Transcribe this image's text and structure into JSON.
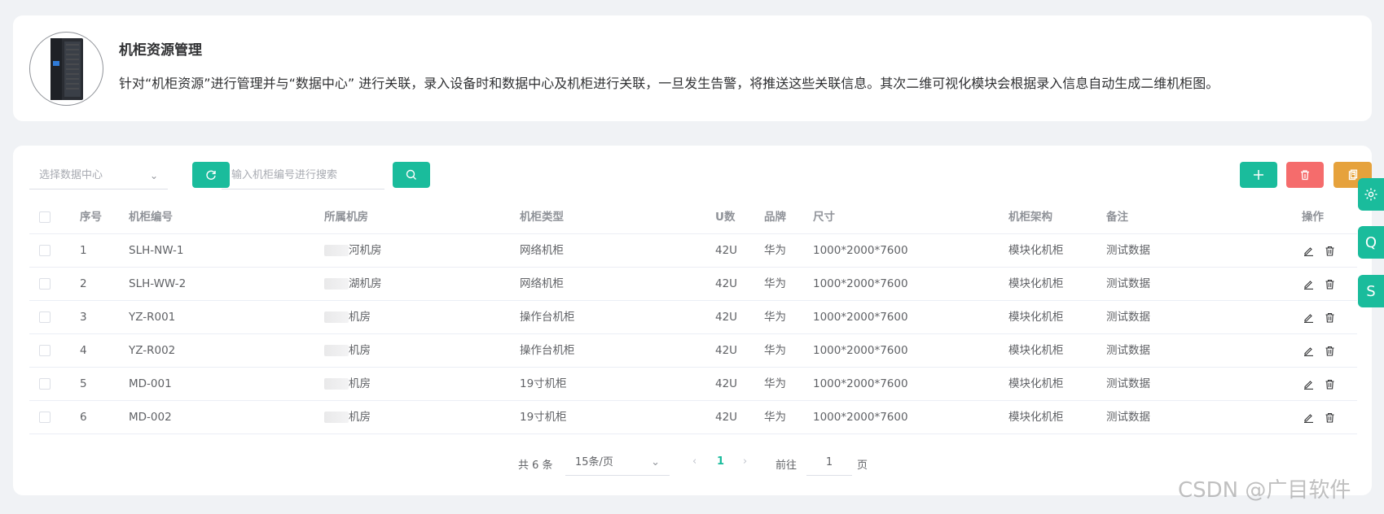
{
  "intro": {
    "title": "机柜资源管理",
    "description": "针对“机柜资源”进行管理并与“数据中心” 进行关联，录入设备时和数据中心及机柜进行关联，一旦发生告警，将推送这些关联信息。其次二维可视化模块会根据录入信息自动生成二维机柜图。"
  },
  "toolbar": {
    "datacenter_placeholder": "选择数据中心",
    "search_placeholder": "输入机柜编号进行搜索"
  },
  "table": {
    "headers": {
      "idx": "序号",
      "code": "机柜编号",
      "room": "所属机房",
      "type": "机柜类型",
      "u": "U数",
      "brand": "品牌",
      "size": "尺寸",
      "arch": "机柜架构",
      "note": "备注",
      "op": "操作"
    },
    "rows": [
      {
        "idx": "1",
        "code": "SLH-NW-1",
        "room": "河机房",
        "type": "网络机柜",
        "u": "42U",
        "brand": "华为",
        "size": "1000*2000*7600",
        "arch": "模块化机柜",
        "note": "测试数据"
      },
      {
        "idx": "2",
        "code": "SLH-WW-2",
        "room": "湖机房",
        "type": "网络机柜",
        "u": "42U",
        "brand": "华为",
        "size": "1000*2000*7600",
        "arch": "模块化机柜",
        "note": "测试数据"
      },
      {
        "idx": "3",
        "code": "YZ-R001",
        "room": "机房",
        "type": "操作台机柜",
        "u": "42U",
        "brand": "华为",
        "size": "1000*2000*7600",
        "arch": "模块化机柜",
        "note": "测试数据"
      },
      {
        "idx": "4",
        "code": "YZ-R002",
        "room": "机房",
        "type": "操作台机柜",
        "u": "42U",
        "brand": "华为",
        "size": "1000*2000*7600",
        "arch": "模块化机柜",
        "note": "测试数据"
      },
      {
        "idx": "5",
        "code": "MD-001",
        "room": "机房",
        "type": "19寸机柜",
        "u": "42U",
        "brand": "华为",
        "size": "1000*2000*7600",
        "arch": "模块化机柜",
        "note": "测试数据"
      },
      {
        "idx": "6",
        "code": "MD-002",
        "room": "机房",
        "type": "19寸机柜",
        "u": "42U",
        "brand": "华为",
        "size": "1000*2000*7600",
        "arch": "模块化机柜",
        "note": "测试数据"
      }
    ]
  },
  "pagination": {
    "total_text": "共 6 条",
    "page_size": "15条/页",
    "current_page": "1",
    "goto_label": "前往",
    "goto_value": "1",
    "page_unit": "页"
  },
  "side_buttons": {
    "q_label": "Q",
    "s_label": "S"
  },
  "watermark": "CSDN @广目软件",
  "colors": {
    "primary": "#1abc9c",
    "danger": "#f56c6c",
    "warning": "#e6a23c"
  }
}
